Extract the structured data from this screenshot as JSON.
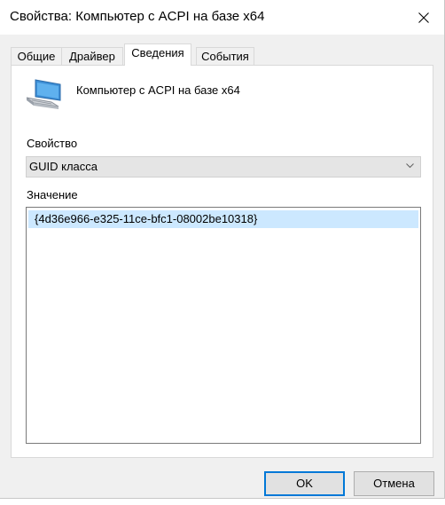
{
  "window": {
    "title": "Свойства: Компьютер с ACPI на базе x64"
  },
  "tabs": [
    {
      "label": "Общие"
    },
    {
      "label": "Драйвер"
    },
    {
      "label": "Сведения"
    },
    {
      "label": "События"
    }
  ],
  "active_tab": "Сведения",
  "device": {
    "name": "Компьютер с ACPI на базе x64",
    "icon": "computer-icon"
  },
  "property": {
    "label": "Свойство",
    "selected": "GUID класса"
  },
  "value": {
    "label": "Значение",
    "items": [
      "{4d36e966-e325-11ce-bfc1-08002be10318}"
    ]
  },
  "buttons": {
    "ok": "OK",
    "cancel": "Отмена"
  },
  "colors": {
    "selection": "#cce8ff",
    "default_button_border": "#0078d7",
    "dialog_bg": "#f0f0f0"
  }
}
